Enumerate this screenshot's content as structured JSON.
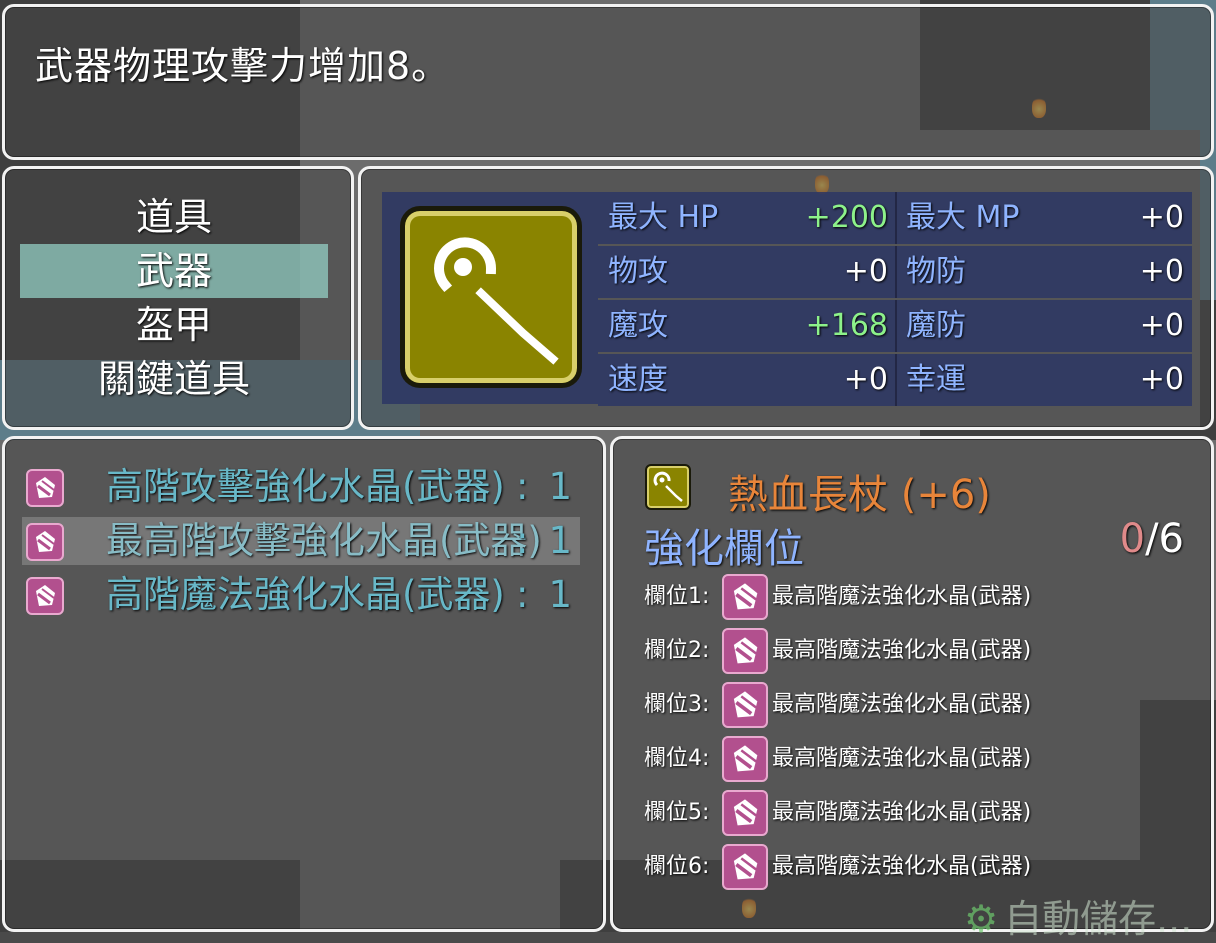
{
  "help": {
    "text": "武器物理攻擊力增加8。"
  },
  "categories": [
    {
      "label": "道具",
      "selected": false
    },
    {
      "label": "武器",
      "selected": true
    },
    {
      "label": "盔甲",
      "selected": false
    },
    {
      "label": "關鍵道具",
      "selected": false
    }
  ],
  "equip_icon": "staff-icon",
  "stats": {
    "rows": [
      {
        "label_a": "最大 HP",
        "value_a": "+200",
        "a_up": true,
        "label_b": "最大 MP",
        "value_b": "+0",
        "b_up": false
      },
      {
        "label_a": "物攻",
        "value_a": "+0",
        "a_up": false,
        "label_b": "物防",
        "value_b": "+0",
        "b_up": false
      },
      {
        "label_a": "魔攻",
        "value_a": "+168",
        "a_up": true,
        "label_b": "魔防",
        "value_b": "+0",
        "b_up": false
      },
      {
        "label_a": "速度",
        "value_a": "+0",
        "a_up": false,
        "label_b": "幸運",
        "value_b": "+0",
        "b_up": false
      }
    ]
  },
  "crystal_list": {
    "items": [
      {
        "name": "高階攻擊強化水晶(武器)",
        "separator": ":",
        "count": "1",
        "icon": "crystal-icon",
        "selected": false
      },
      {
        "name": "最高階攻擊強化水晶(武器)",
        "separator": ":",
        "count": "1",
        "icon": "crystal-icon",
        "selected": true
      },
      {
        "name": "高階魔法強化水晶(武器)",
        "separator": ":",
        "count": "1",
        "icon": "crystal-icon",
        "selected": false
      }
    ]
  },
  "detail": {
    "weapon_icon": "staff-icon",
    "weapon_name": "熱血長杖 (+6)",
    "slot_title": "強化欄位",
    "slot_used": "0",
    "slot_total": "/6",
    "slots": [
      {
        "label": "欄位1:",
        "item": "最高階魔法強化水晶(武器)"
      },
      {
        "label": "欄位2:",
        "item": "最高階魔法強化水晶(武器)"
      },
      {
        "label": "欄位3:",
        "item": "最高階魔法強化水晶(武器)"
      },
      {
        "label": "欄位4:",
        "item": "最高階魔法強化水晶(武器)"
      },
      {
        "label": "欄位5:",
        "item": "最高階魔法強化水晶(武器)"
      },
      {
        "label": "欄位6:",
        "item": "最高階魔法強化水晶(武器)"
      }
    ]
  },
  "autosave": {
    "text": "自動儲存...",
    "icon": "gear-icon"
  },
  "colors": {
    "stat_label": "#8fb4ff",
    "stat_up": "#8df28a",
    "list_text": "#68b8c8",
    "weapon_name": "#e8853a",
    "crystal": "#b2508e",
    "category_highlight": "#96d2c8"
  }
}
